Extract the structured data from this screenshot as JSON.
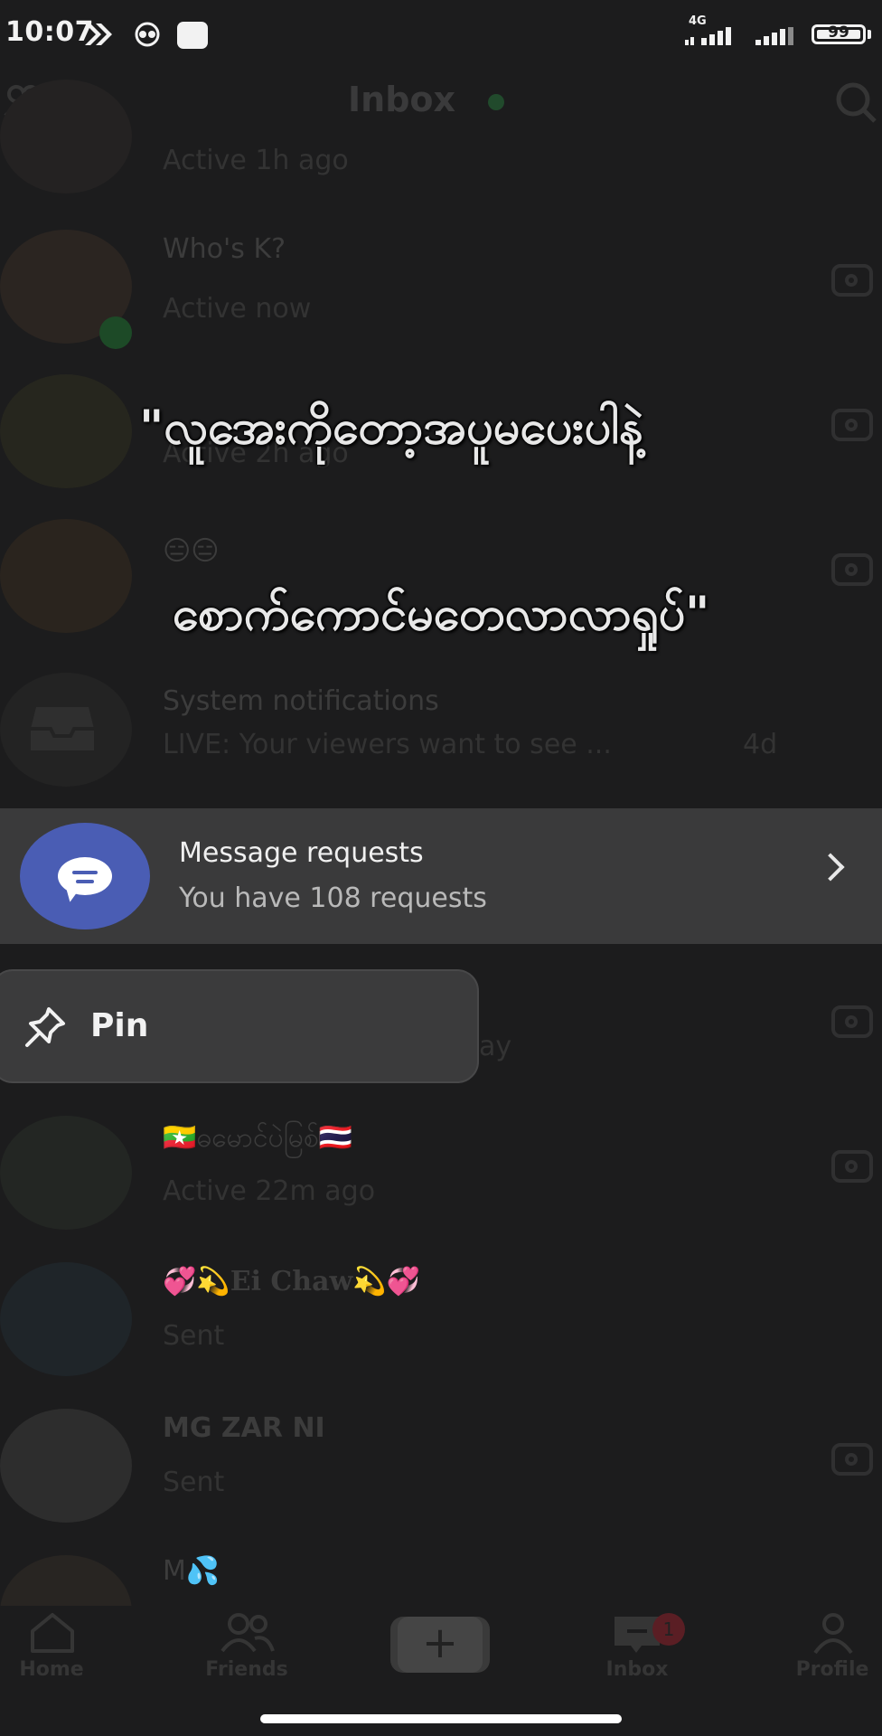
{
  "status_bar": {
    "time": "10:07",
    "network": "4G",
    "battery": "99",
    "battery_level": 0.99
  },
  "header": {
    "title": "Inbox",
    "left_icon": "add-friend-icon",
    "right_icon": "search-icon"
  },
  "conversations": [
    {
      "name": "",
      "status": "Active 1h ago"
    },
    {
      "name": "Who's K?",
      "status": "Active now"
    },
    {
      "name": "",
      "status": "Active 2h ago"
    },
    {
      "name": "😑😑",
      "status": ""
    },
    {
      "name": "System notifications",
      "status": "LIVE: Your viewers want to see ...",
      "time": "4d"
    },
    {
      "name": "🇲🇲ဓမောင်ပဲမြစ်🇹🇭",
      "status": "Active 22m ago"
    },
    {
      "name": "💞💫Ei Chaw💫💞",
      "status": "Sent"
    },
    {
      "name": "MG ZAR NI",
      "status": "Sent"
    },
    {
      "name": "M💦",
      "status": ""
    }
  ],
  "caption": {
    "line1": "\"လူအေးကိုတော့အပူမပေးပါနဲ့",
    "line2": "စောက်ကောင်မတေလာလာရှုပ်\""
  },
  "message_requests": {
    "title": "Message requests",
    "subtitle": "You have 108 requests"
  },
  "context_menu": {
    "pin_label": "Pin",
    "partial_text": "ay"
  },
  "bottom_nav": {
    "home": "Home",
    "friends": "Friends",
    "create": "+",
    "inbox": "Inbox",
    "inbox_badge": "1",
    "profile": "Profile"
  }
}
